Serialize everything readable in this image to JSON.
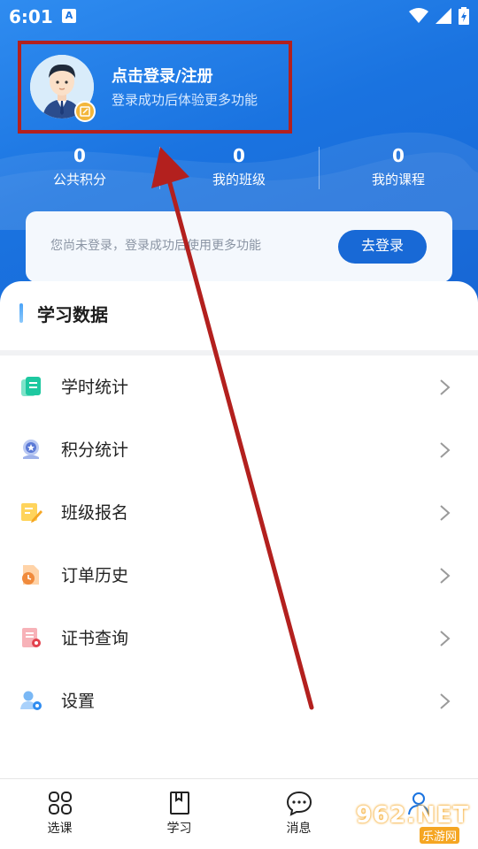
{
  "status_bar": {
    "time": "6:01",
    "notif_icon": "A"
  },
  "profile": {
    "title": "点击登录/注册",
    "subtitle": "登录成功后体验更多功能"
  },
  "stats": [
    {
      "value": "0",
      "label": "公共积分"
    },
    {
      "value": "0",
      "label": "我的班级"
    },
    {
      "value": "0",
      "label": "我的课程"
    }
  ],
  "login_card": {
    "text": "您尚未登录，登录成功后使用更多功能",
    "button": "去登录"
  },
  "section": {
    "title": "学习数据"
  },
  "menu": [
    {
      "label": "学时统计",
      "icon": "study-hours-icon"
    },
    {
      "label": "积分统计",
      "icon": "medal-icon"
    },
    {
      "label": "班级报名",
      "icon": "edit-form-icon"
    },
    {
      "label": "订单历史",
      "icon": "order-clock-icon"
    },
    {
      "label": "证书查询",
      "icon": "certificate-icon"
    },
    {
      "label": "设置",
      "icon": "user-settings-icon"
    }
  ],
  "bottom_nav": [
    {
      "label": "选课",
      "icon": "grid-icon"
    },
    {
      "label": "学习",
      "icon": "book-icon"
    },
    {
      "label": "消息",
      "icon": "chat-icon"
    },
    {
      "label": "",
      "icon": "profile-icon"
    }
  ],
  "watermark": {
    "brand": "962.NET",
    "sub": "乐游网"
  },
  "colors": {
    "header_blue": "#1a73e0",
    "button_blue": "#1869d6",
    "highlight_red": "#b3201e"
  }
}
